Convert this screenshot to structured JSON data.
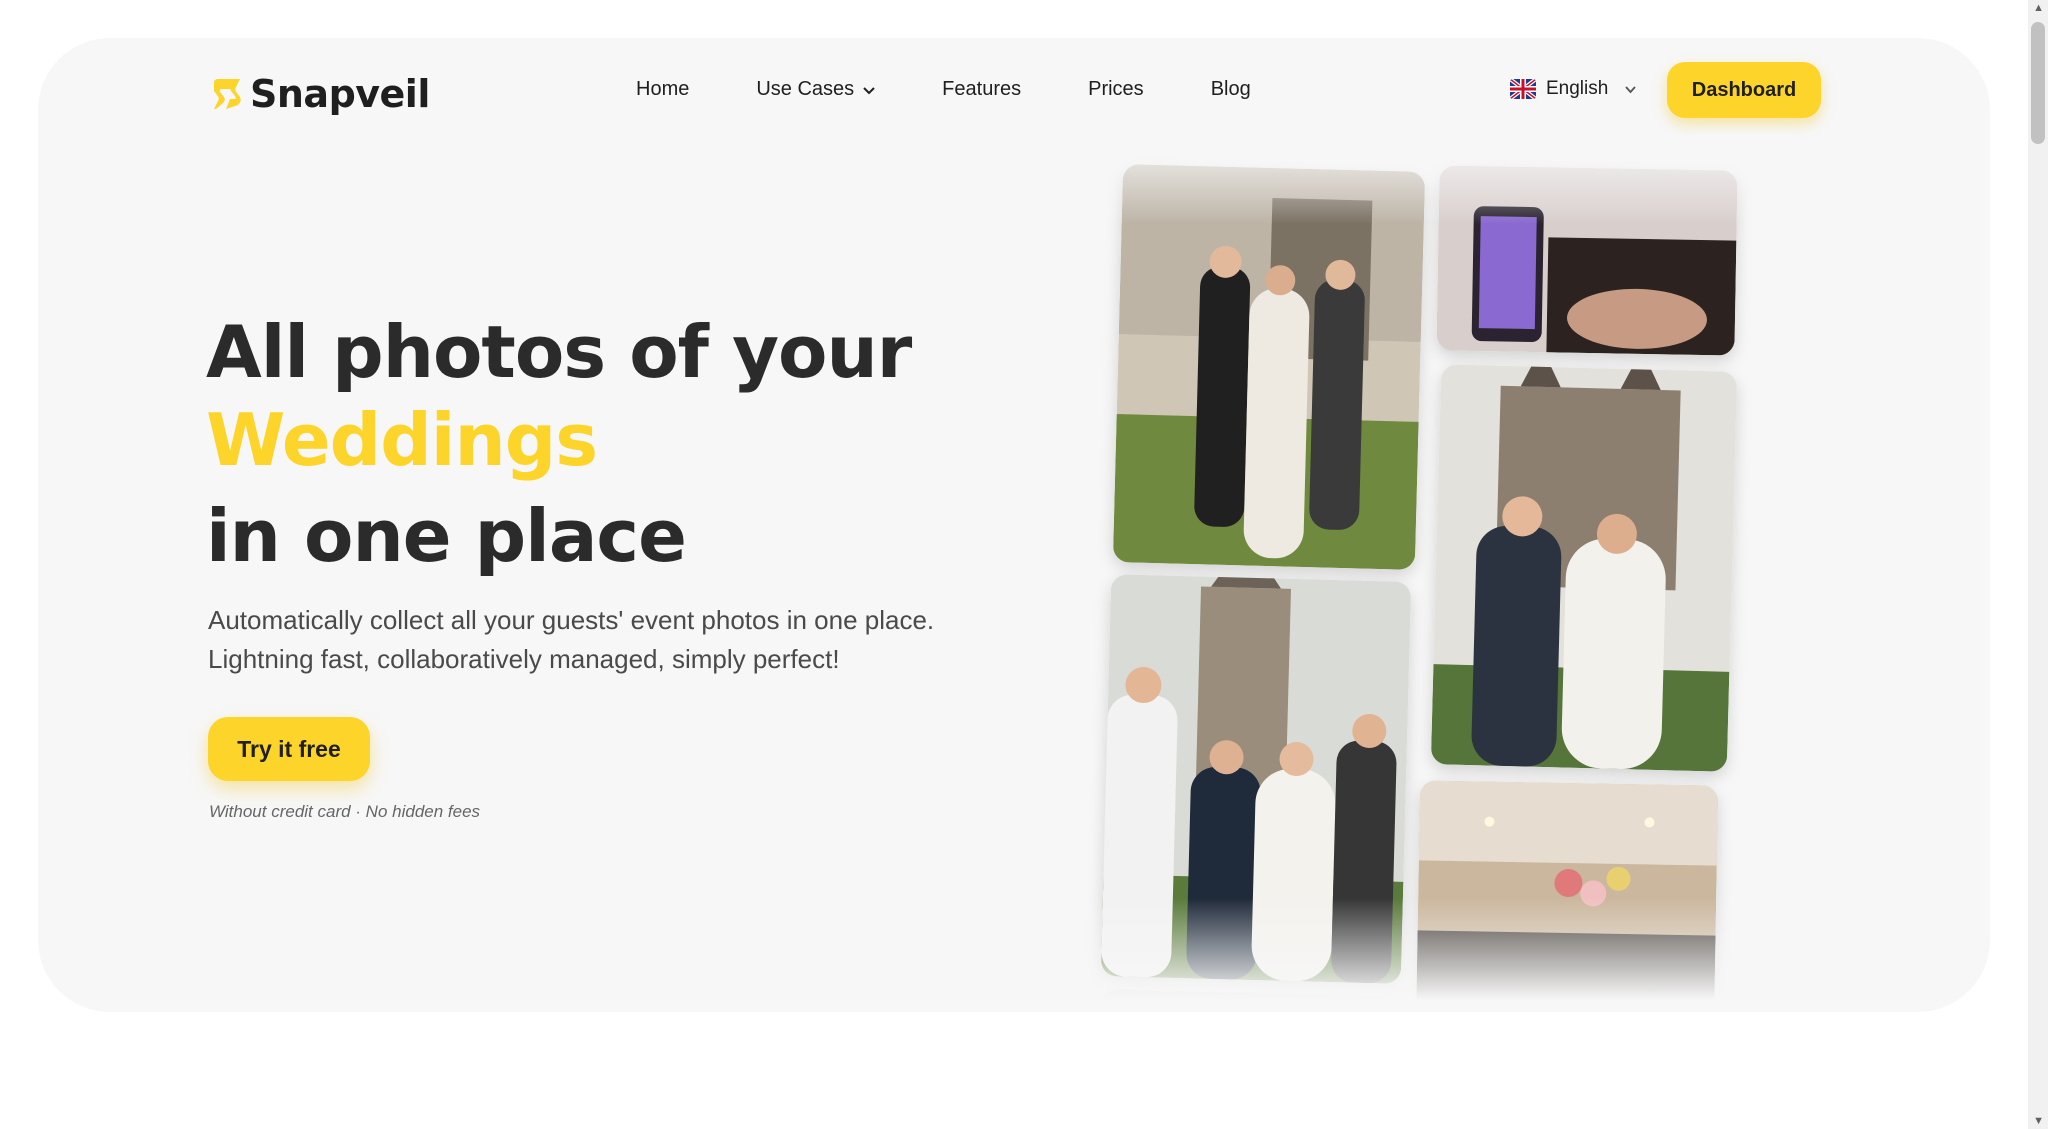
{
  "brand": {
    "name": "Snapveil",
    "accent_color": "#fdd42a"
  },
  "nav": {
    "items": [
      {
        "label": "Home",
        "has_dropdown": false
      },
      {
        "label": "Use Cases",
        "has_dropdown": true
      },
      {
        "label": "Features",
        "has_dropdown": false
      },
      {
        "label": "Prices",
        "has_dropdown": false
      },
      {
        "label": "Blog",
        "has_dropdown": false
      }
    ],
    "language": {
      "label": "English",
      "flag": "uk-flag-icon"
    },
    "dashboard_label": "Dashboard"
  },
  "hero": {
    "title_line1": "All photos of your",
    "title_accent": "Weddings",
    "title_line3": "in one place",
    "subtitle_line1": "Automatically collect all your guests' event photos in one place.",
    "subtitle_line2": "Lightning fast, collaboratively managed, simply perfect!",
    "cta_label": "Try it free",
    "cta_note": "Without credit card · No hidden fees"
  }
}
